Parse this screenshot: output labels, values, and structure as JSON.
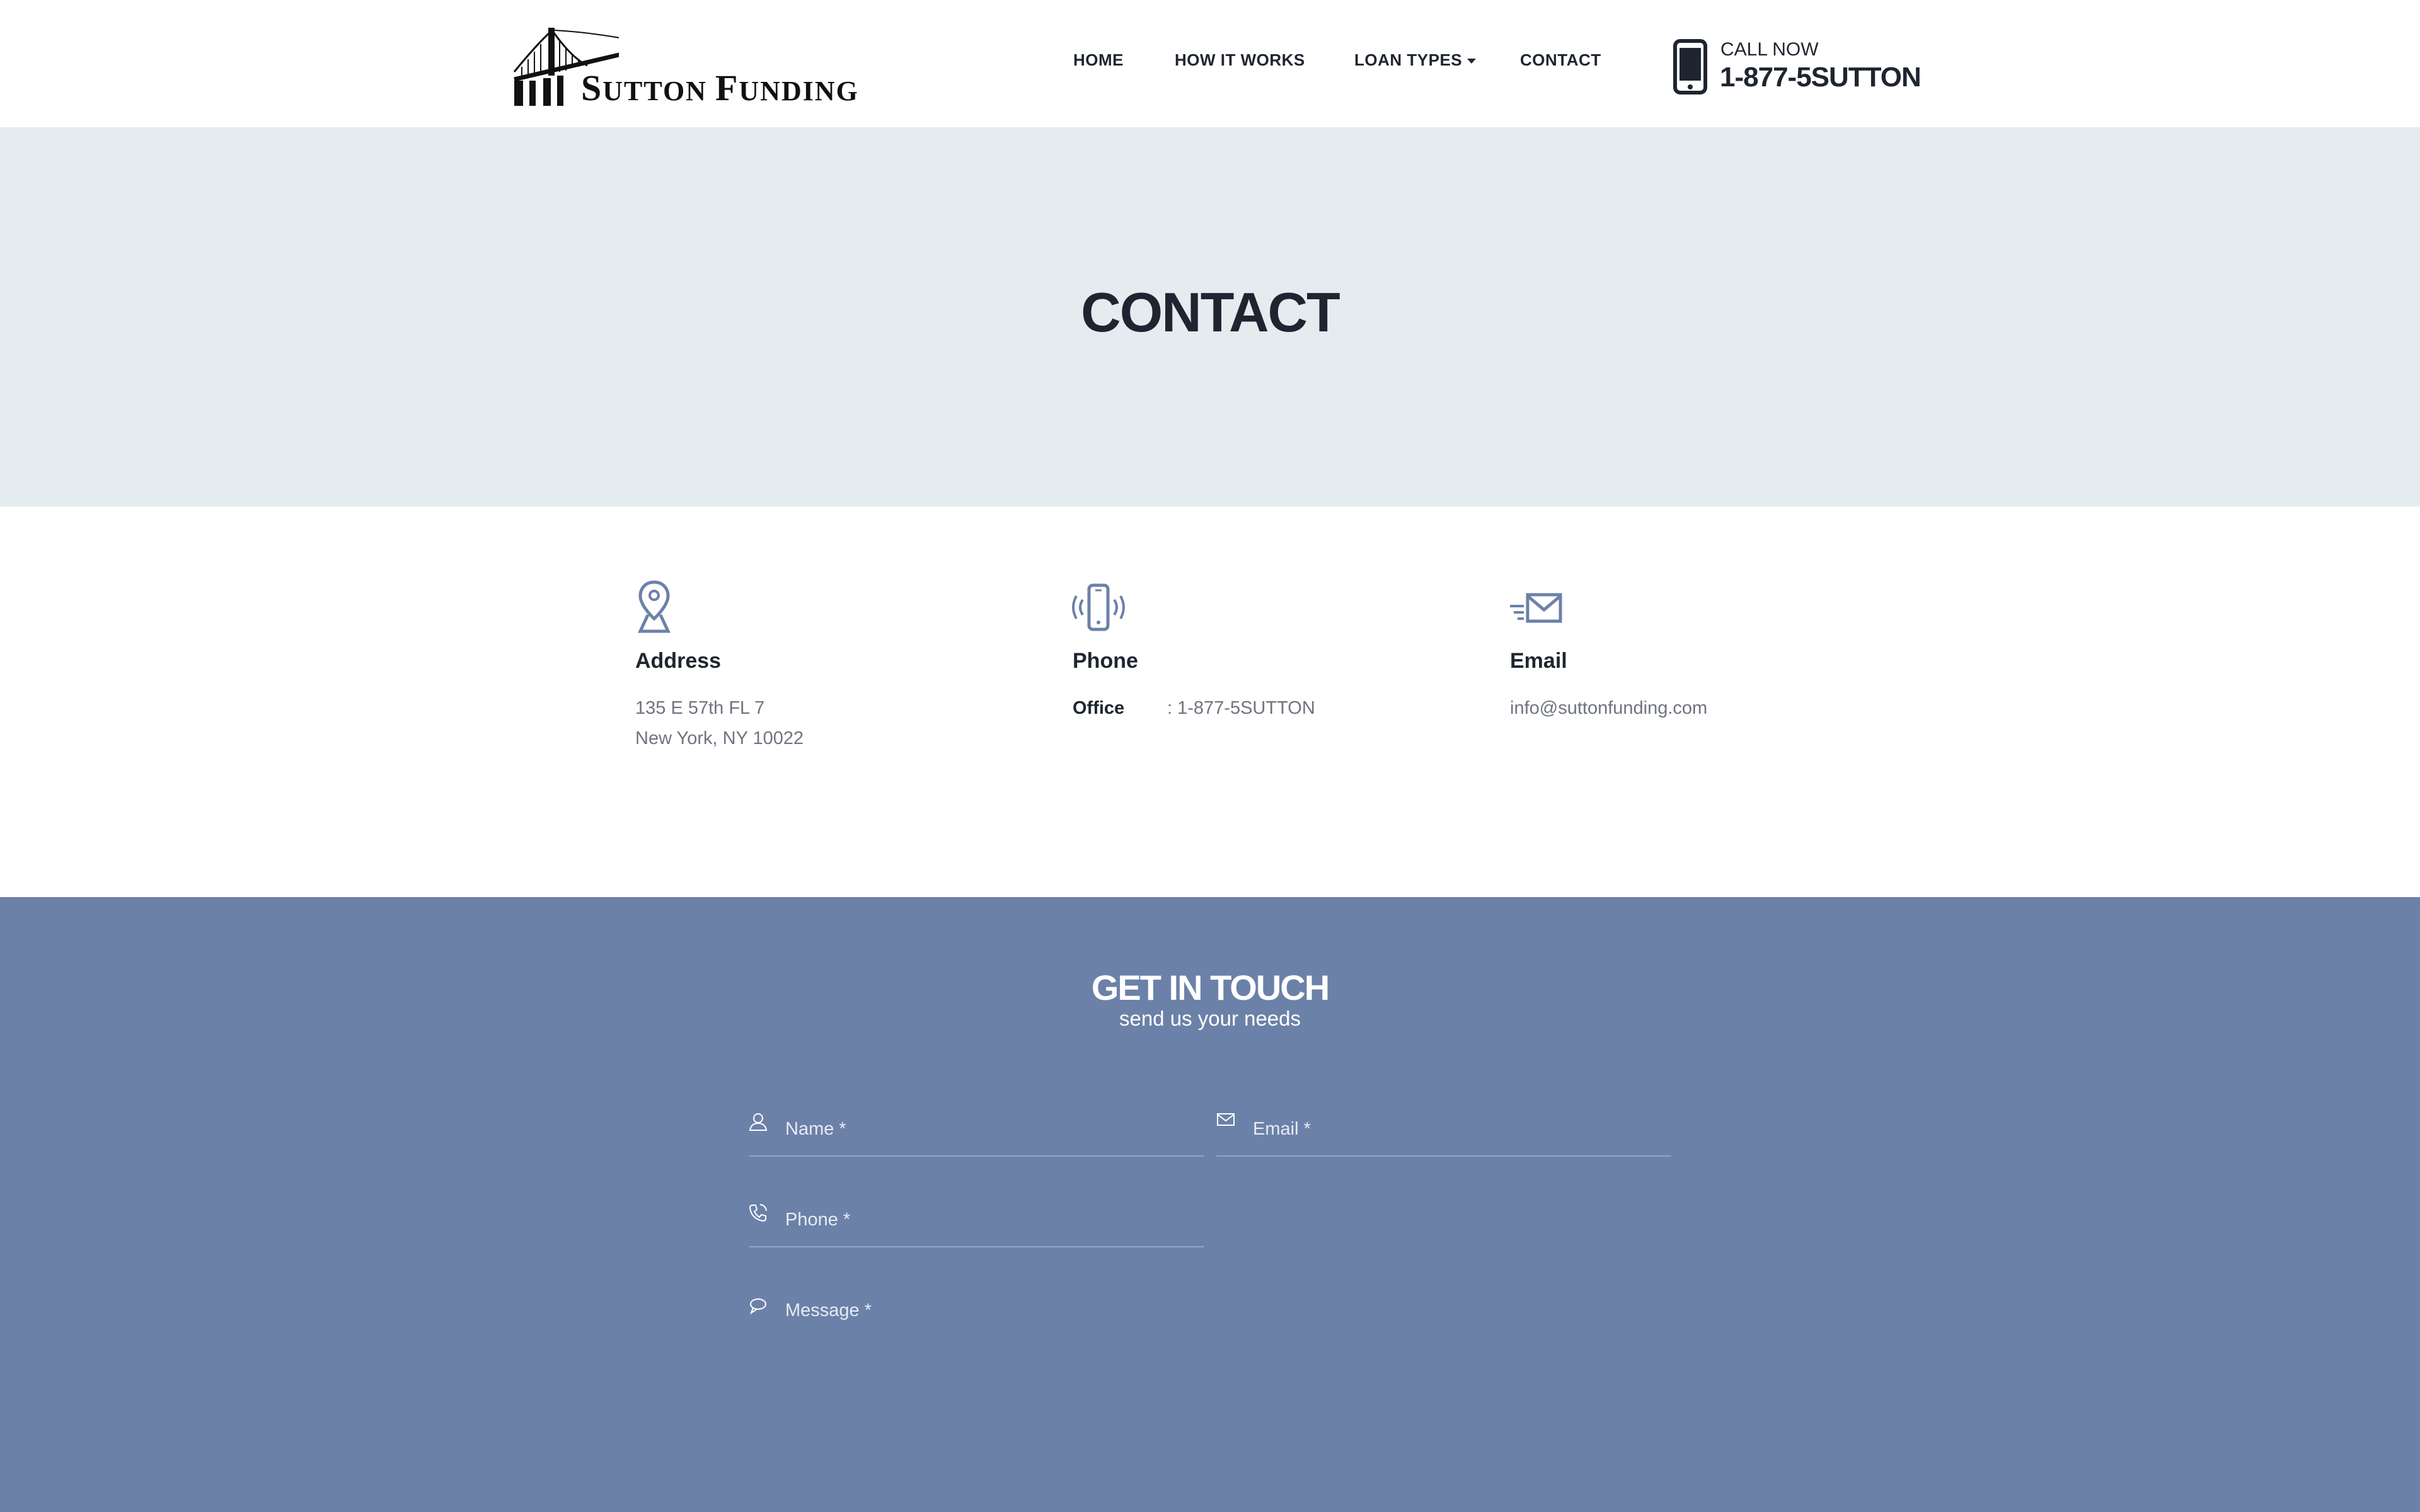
{
  "brand": {
    "name_first_initial": "S",
    "name_first_rest": "UTTON",
    "name_second_initial": "F",
    "name_second_rest": "UNDING",
    "logo_icon": "bridge-icon"
  },
  "nav": {
    "items": [
      "HOME",
      "HOW IT WORKS",
      "LOAN TYPES",
      "CONTACT"
    ]
  },
  "call": {
    "label": "CALL NOW",
    "number": "1-877-5SUTTON",
    "icon": "smartphone-icon"
  },
  "hero": {
    "title": "CONTACT"
  },
  "info": {
    "address": {
      "icon": "map-pin-icon",
      "title": "Address",
      "line1": "135 E 57th FL 7",
      "line2": "New York, NY 10022"
    },
    "phone": {
      "icon": "vibrating-phone-icon",
      "title": "Phone",
      "office_label": "Office",
      "office_value": ": 1-877-5SUTTON"
    },
    "email": {
      "icon": "envelope-fast-icon",
      "title": "Email",
      "value": "info@suttonfunding.com"
    }
  },
  "contact_form": {
    "title": "GET IN TOUCH",
    "subtitle": "send us your needs",
    "name_placeholder": "Name *",
    "email_placeholder": "Email *",
    "phone_placeholder": "Phone *",
    "message_placeholder": "Message *"
  },
  "colors": {
    "text_dark": "#1f2530",
    "hero_bg": "#e5ecef",
    "form_bg": "#6c81a8",
    "icon_blue": "#6c81a8"
  }
}
